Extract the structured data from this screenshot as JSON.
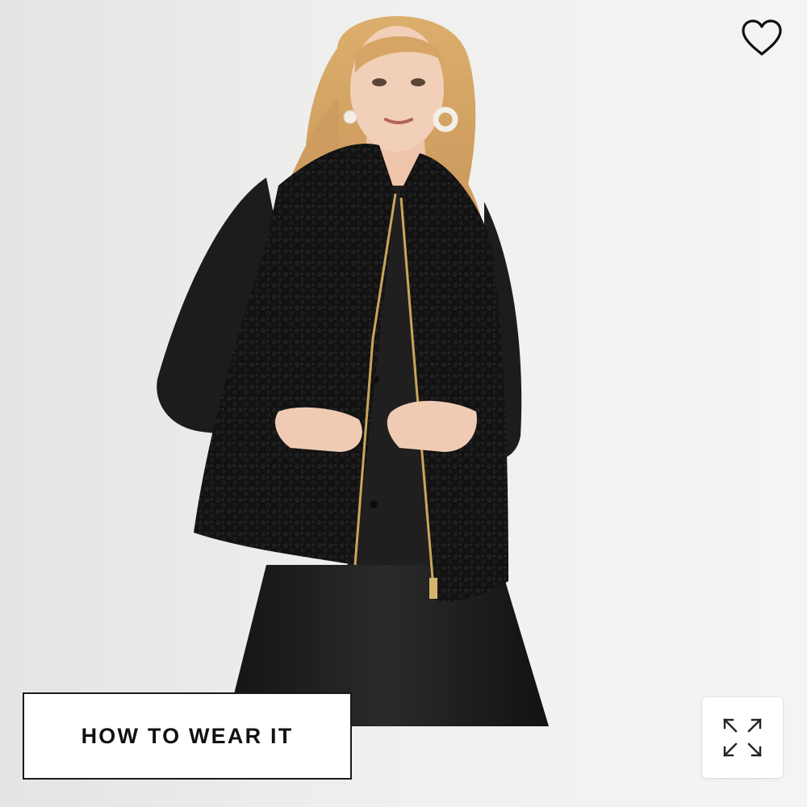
{
  "product_image": {
    "alt_icon": "product-photo"
  },
  "wishlist": {
    "icon": "heart-outline-icon"
  },
  "how_to_wear": {
    "label": "HOW TO WEAR IT"
  },
  "expand": {
    "icon": "expand-arrows-icon"
  },
  "colors": {
    "background": "#efefed",
    "vest": "#141414",
    "shirt": "#1c1c1c",
    "zipper": "#c9a65a",
    "hair": "#d4a464",
    "skin": "#f2cfb8",
    "button_border": "#1a1a1a"
  }
}
